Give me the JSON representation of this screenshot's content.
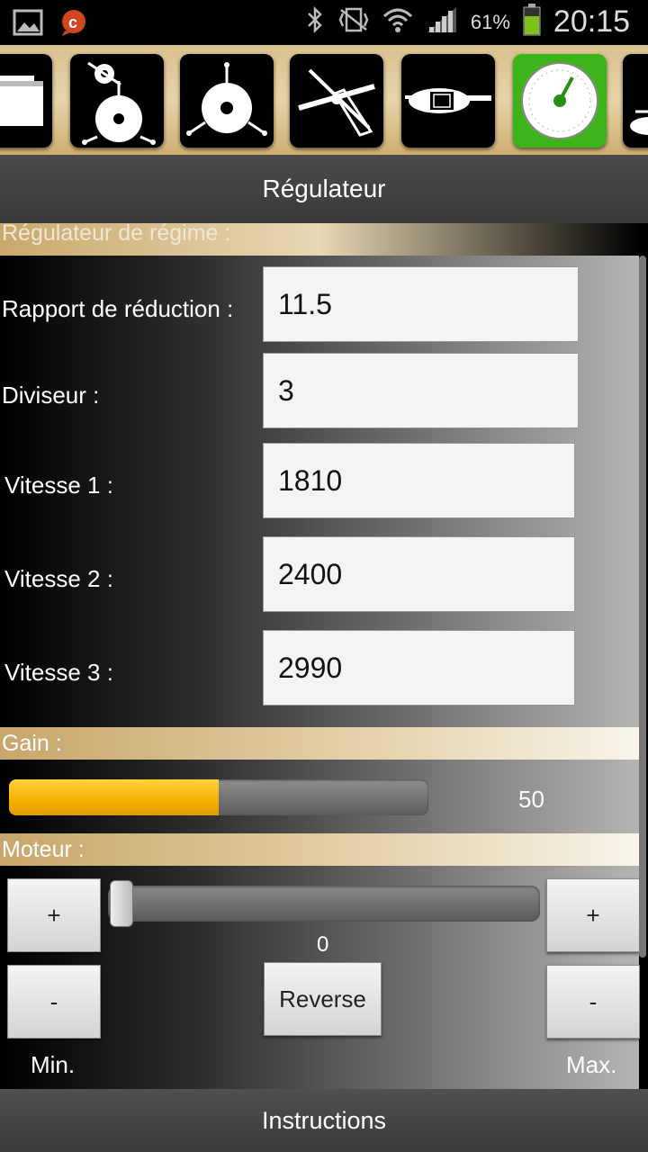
{
  "status_bar": {
    "battery_percent": "61%",
    "time": "20:15",
    "icons": [
      "gallery-icon",
      "notification-c-icon",
      "bluetooth-icon",
      "vibrate-icon",
      "wifi-icon",
      "signal-icon",
      "battery-icon"
    ]
  },
  "toolbar": {
    "items": [
      {
        "name": "folder-tab-icon",
        "active": false
      },
      {
        "name": "swashplate-icon",
        "active": false
      },
      {
        "name": "servo-disk-icon",
        "active": false
      },
      {
        "name": "rotor-blade-icon",
        "active": false
      },
      {
        "name": "helicopter-icon",
        "active": false
      },
      {
        "name": "gauge-icon",
        "active": true
      },
      {
        "name": "next-icon",
        "active": false
      }
    ],
    "accent": "#3db51a"
  },
  "title": "Régulateur",
  "governor_section": {
    "header": "Régulateur de régime :",
    "fields": [
      {
        "label": "Rapport de réduction :",
        "value": "11.5"
      },
      {
        "label": "Diviseur :",
        "value": "3"
      },
      {
        "label": "Vitesse 1 :",
        "value": "1810"
      },
      {
        "label": "Vitesse 2 :",
        "value": "2400"
      },
      {
        "label": "Vitesse 3 :",
        "value": "2990"
      }
    ]
  },
  "gain_section": {
    "header": "Gain :",
    "value": "50",
    "fill_fraction": 0.5,
    "fill_color": "#f5b000"
  },
  "motor_section": {
    "header": "Moteur :",
    "min_plus": "+",
    "min_minus": "-",
    "max_plus": "+",
    "max_minus": "-",
    "slider_value": "0",
    "reverse_label": "Reverse",
    "min_label": "Min.",
    "max_label": "Max."
  },
  "footer": {
    "instructions_label": "Instructions"
  }
}
